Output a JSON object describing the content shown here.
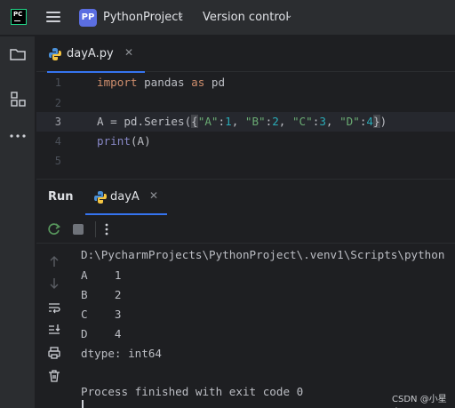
{
  "app": {
    "logo_text": "PC",
    "project_badge": "PP",
    "project_name": "PythonProject",
    "vcs_label": "Version control"
  },
  "editor": {
    "tab_label": "dayA.py",
    "line_numbers": [
      "1",
      "2",
      "3",
      "4",
      "5"
    ],
    "code": {
      "l1_kw1": "import",
      "l1_mid": " pandas ",
      "l1_kw2": "as",
      "l1_end": " pd",
      "l3_a": "A = pd.Series(",
      "l3_ob": "{",
      "l3_k1": "\"A\"",
      "l3_c1": ":",
      "l3_v1": "1",
      "l3_s1": ", ",
      "l3_k2": "\"B\"",
      "l3_c2": ":",
      "l3_v2": "2",
      "l3_s2": ", ",
      "l3_k3": "\"C\"",
      "l3_c3": ":",
      "l3_v3": "3",
      "l3_s3": ", ",
      "l3_k4": "\"D\"",
      "l3_c4": ":",
      "l3_v4": "4",
      "l3_cb": "}",
      "l3_end": ")",
      "l4_fn": "print",
      "l4_end": "(A)"
    }
  },
  "run": {
    "title": "Run",
    "tab_label": "dayA",
    "console_lines": [
      "D:\\PycharmProjects\\PythonProject\\.venv1\\Scripts\\python",
      "A    1",
      "B    2",
      "C    3",
      "D    4",
      "dtype: int64",
      "",
      "Process finished with exit code 0"
    ]
  },
  "watermark": "CSDN @小星袁",
  "colors": {
    "accent": "#3574f0",
    "background": "#1e1f22",
    "panel": "#2b2d30",
    "keyword": "#cf8e6d",
    "string": "#6aab73",
    "number": "#2aacb8",
    "builtin": "#8888c6"
  },
  "icons": {
    "leftstrip": [
      "folder-icon",
      "structure-icon",
      "more-icon"
    ],
    "run_toolbar": [
      "rerun-icon",
      "stop-icon",
      "more-vertical-icon"
    ],
    "run_side": [
      "scroll-up-icon",
      "scroll-down-icon",
      "soft-wrap-icon",
      "scroll-to-end-icon",
      "print-icon",
      "trash-icon"
    ]
  }
}
